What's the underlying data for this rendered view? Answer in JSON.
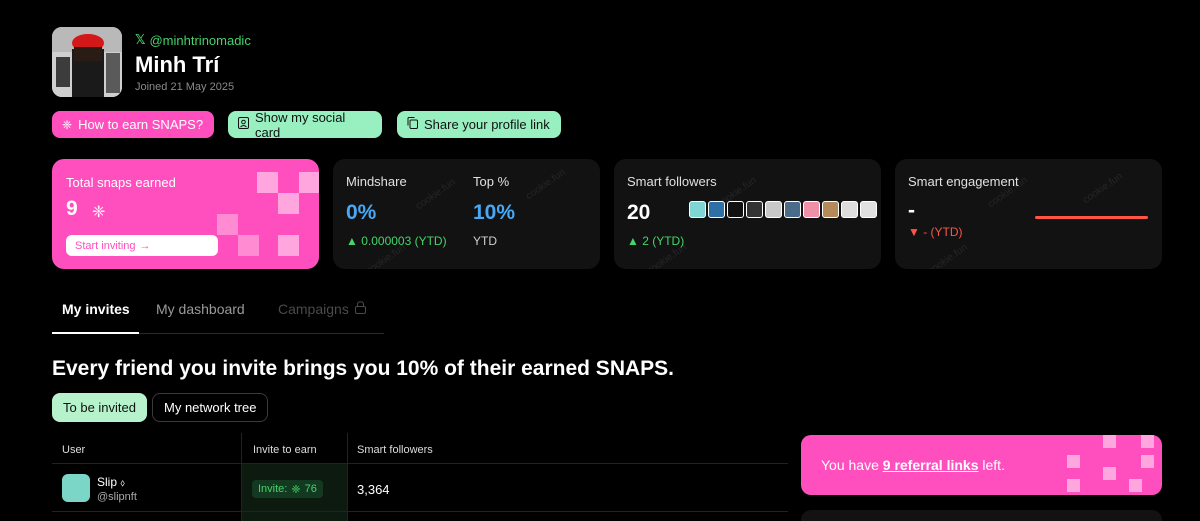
{
  "profile": {
    "x_mark": "𝕏",
    "handle": "@minhtrinomadic",
    "name": "Minh Trí",
    "joined": "Joined 21 May 2025"
  },
  "actions": {
    "earn_label": "How to earn SNAPS?",
    "social_card_label": "Show my social card",
    "profile_link_label": "Share your profile link"
  },
  "cards": {
    "snaps": {
      "label": "Total snaps earned",
      "value": "9",
      "invite_label": "Start inviting",
      "arrow": "→"
    },
    "mindshare": {
      "label": "Mindshare",
      "value": "0%",
      "change": "▲ 0.000003 (YTD)",
      "top_label": "Top %",
      "top_value": "10%",
      "top_sub": "YTD"
    },
    "followers": {
      "label": "Smart followers",
      "value": "20",
      "change": "▲ 2 (YTD)"
    },
    "engagement": {
      "label": "Smart engagement",
      "value": "-",
      "change": "▼ - (YTD)"
    },
    "watermark": "cookie.fun"
  },
  "tabs": {
    "invites": "My invites",
    "dashboard": "My dashboard",
    "campaigns": "Campaigns"
  },
  "headline": "Every friend you invite brings you 10% of their earned SNAPS.",
  "filters": {
    "to_be_invited": "To be invited",
    "network_tree": "My network tree"
  },
  "table": {
    "headers": [
      "User",
      "Invite to earn",
      "Smart followers"
    ],
    "rows": [
      {
        "name": "Slip",
        "handle": "@slipnft",
        "invite_label": "Invite:",
        "invite_value": "76",
        "smart_followers": "3,364"
      }
    ]
  },
  "referral": {
    "prefix": "You have ",
    "link": "9 referral links",
    "suffix": " left."
  },
  "colors": {
    "pink": "#ff4fbf",
    "green": "#45d36a",
    "blue": "#48a8f5",
    "red": "#ff5544",
    "mint": "#98f0c0"
  }
}
